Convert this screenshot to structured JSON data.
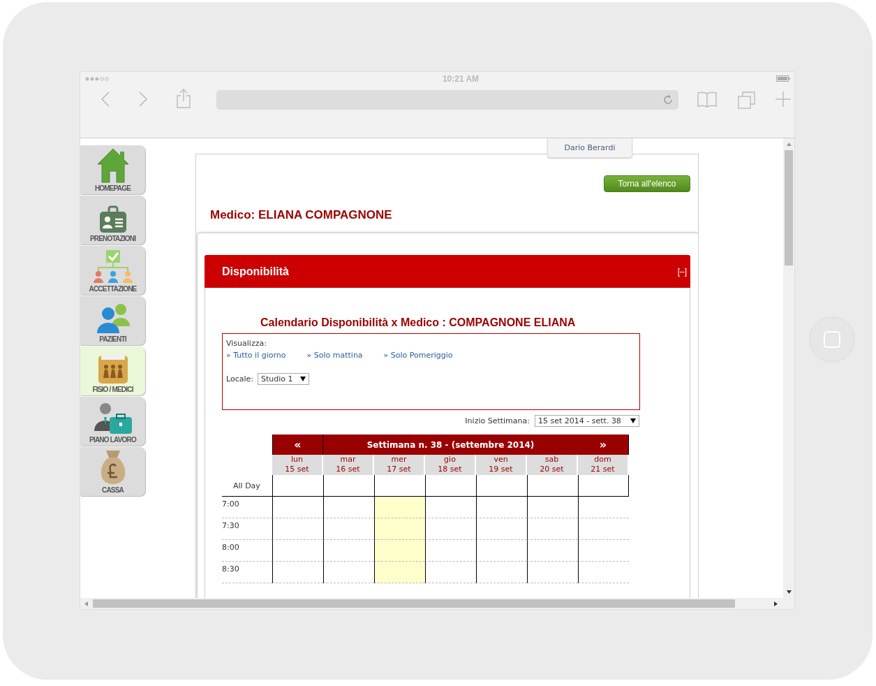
{
  "status_bar": {
    "time": "10:21 AM"
  },
  "sidebar": {
    "items": [
      {
        "label": "HOMEPAGE",
        "kind": "house",
        "selected": false
      },
      {
        "label": "PRENOTAZIONI",
        "kind": "card",
        "selected": false
      },
      {
        "label": "ACCETTAZIONE",
        "kind": "org",
        "selected": false
      },
      {
        "label": "PAZIENTI",
        "kind": "people",
        "selected": false
      },
      {
        "label": "FISIO / MEDICI",
        "kind": "folder",
        "selected": true
      },
      {
        "label": "PIANO LAVORO",
        "kind": "briefcase",
        "selected": false
      },
      {
        "label": "CASSA",
        "kind": "bag",
        "selected": false
      }
    ]
  },
  "user_tab": "Dario Berardi",
  "back_button": "Torna all'elenco",
  "doctor_title": "Medico: ELIANA COMPAGNONE",
  "panel": {
    "title": "Disponibilità",
    "collapse": "[–]"
  },
  "calendar_title": "Calendario Disponibilità x Medico : COMPAGNONE ELIANA",
  "filter": {
    "label": "Visualizza:",
    "options": [
      "» Tutto il giorno",
      "» Solo mattina",
      "» Solo Pomeriggio"
    ],
    "locale_label": "Locale:",
    "locale_value": "Studio 1"
  },
  "week_start": {
    "label": "Inizio Settimana:",
    "value": "15 set 2014 - sett. 38"
  },
  "calendar": {
    "prev": "«",
    "title": "Settimana n. 38 - (settembre 2014)",
    "next": "»",
    "all_day": "All Day",
    "days": [
      {
        "name": "lun",
        "date": "15 set",
        "today": false
      },
      {
        "name": "mar",
        "date": "16 set",
        "today": false
      },
      {
        "name": "mer",
        "date": "17 set",
        "today": true
      },
      {
        "name": "gio",
        "date": "18 set",
        "today": false
      },
      {
        "name": "ven",
        "date": "19 set",
        "today": false
      },
      {
        "name": "sab",
        "date": "20 set",
        "today": false
      },
      {
        "name": "dom",
        "date": "21 set",
        "today": false
      }
    ],
    "times": [
      "7:00",
      "7:30",
      "8:00",
      "8:30"
    ]
  }
}
